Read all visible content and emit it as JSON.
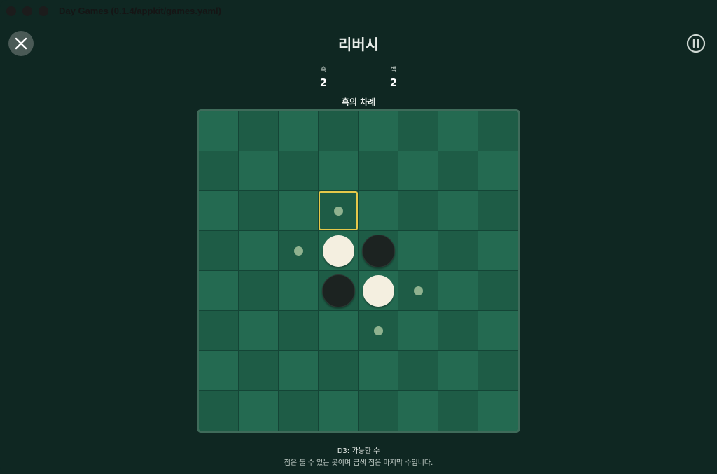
{
  "window": {
    "title": "Day Games (0.1.4/appkit/games.yaml)"
  },
  "header": {
    "title": "리버시"
  },
  "score": {
    "black": {
      "label": "흑",
      "value": "2"
    },
    "white": {
      "label": "백",
      "value": "2"
    }
  },
  "status": {
    "turn": "흑의 차례"
  },
  "info": {
    "line1": "D3: 가능한 수",
    "line2": "점은 둘 수 있는 곳이며 금색 점은 마지막 수입니다."
  },
  "board": {
    "rows": [
      [
        "",
        "",
        "",
        "",
        "",
        "",
        "",
        ""
      ],
      [
        "",
        "",
        "",
        "",
        "",
        "",
        "",
        ""
      ],
      [
        "",
        "",
        "",
        "hint",
        "",
        "",
        "",
        ""
      ],
      [
        "",
        "",
        "hint",
        "white",
        "black",
        "",
        "",
        ""
      ],
      [
        "",
        "",
        "",
        "black",
        "white",
        "hint",
        "",
        ""
      ],
      [
        "",
        "",
        "",
        "",
        "hint",
        "",
        "",
        ""
      ],
      [
        "",
        "",
        "",
        "",
        "",
        "",
        "",
        ""
      ],
      [
        "",
        "",
        "",
        "",
        "",
        "",
        "",
        ""
      ]
    ],
    "selected": {
      "row": 2,
      "col": 3
    }
  },
  "colors": {
    "background": "#0f2722",
    "cell_light": "#246a51",
    "cell_dark": "#1e5c46",
    "highlight": "#e5c84a",
    "hint": "#8fb28f"
  },
  "icons": {
    "close": "close-icon",
    "pause": "pause-icon"
  }
}
